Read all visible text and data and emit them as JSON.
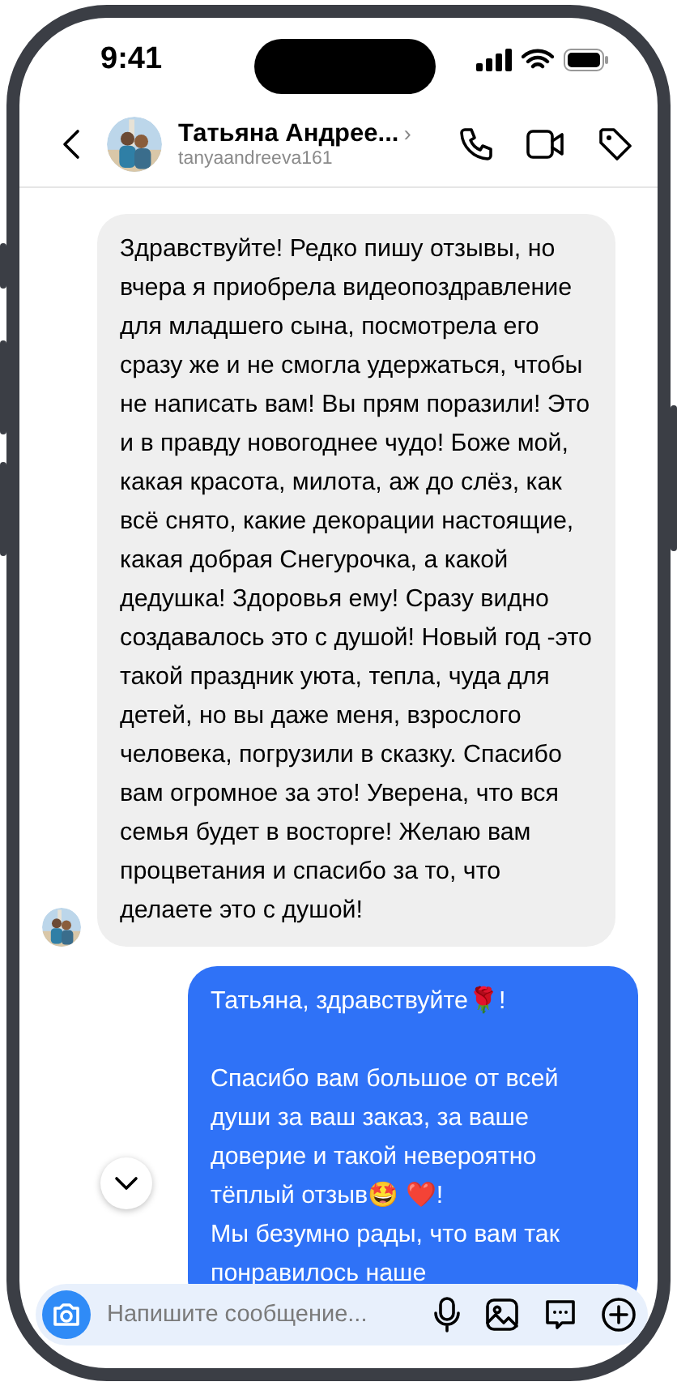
{
  "status_bar": {
    "time": "9:41"
  },
  "header": {
    "name": "Татьяна Андрее...",
    "chevron": "›",
    "username": "tanyaandreeva161"
  },
  "messages": [
    {
      "kind": "incoming",
      "text": "Здравствуйте! Редко пишу отзывы, но вчера я приобрела видеопоздравление для младшего сына, посмотрела его сразу же и не смогла удержаться, чтобы не написать вам! Вы прям поразили! Это и в правду новогоднее чудо! Боже мой, какая красота, милота, аж до слёз, как всё снято, какие декорации настоящие, какая добрая Снегурочка, а какой дедушка! Здоровья ему! Сразу видно создавалось это с душой! Новый год -это такой праздник уюта, тепла, чуда для детей, но вы даже меня, взрослого человека, погрузили в сказку. Спасибо вам огромное за это! Уверена, что вся семья будет в восторге! Желаю вам процветания и спасибо за то, что делаете это с душой!"
    },
    {
      "kind": "outgoing",
      "text": "Татьяна, здравствуйте🌹!\n\nСпасибо вам большое от всей души за ваш заказ, за ваше доверие и такой невероятно тёплый отзыв🤩 ❤️!\nМы безумно рады, что вам так понравилось наше"
    }
  ],
  "composer": {
    "placeholder": "Напишите сообщение..."
  }
}
